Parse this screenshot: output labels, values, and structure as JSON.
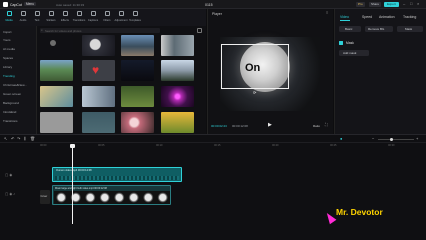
{
  "app": {
    "name": "CapCut",
    "menu": "Menu",
    "autosave": "Auto saved: 11:30:33",
    "project": "0115",
    "pro_label": "Pro",
    "share_label": "Share",
    "export_label": "Export"
  },
  "toolbar": {
    "items": [
      {
        "label": "Media",
        "icon": "media-icon",
        "active": true
      },
      {
        "label": "Audio",
        "icon": "audio-icon",
        "active": false
      },
      {
        "label": "Text",
        "icon": "text-icon",
        "active": false
      },
      {
        "label": "Stickers",
        "icon": "stickers-icon",
        "active": false
      },
      {
        "label": "Effects",
        "icon": "effects-icon",
        "active": false
      },
      {
        "label": "Transitions",
        "icon": "transitions-icon",
        "active": false
      },
      {
        "label": "Captions",
        "icon": "captions-icon",
        "active": false
      },
      {
        "label": "Filters",
        "icon": "filters-icon",
        "active": false
      },
      {
        "label": "Adjustment",
        "icon": "adjustment-icon",
        "active": false
      },
      {
        "label": "Templates",
        "icon": "templates-icon",
        "active": false
      }
    ]
  },
  "sidebar": {
    "items": [
      "Import",
      "Yours",
      "AI media",
      "Spaces",
      "Library",
      "Trending",
      "Christmas&New...",
      "Green screen",
      "Background",
      "Intro&End",
      "Transitions"
    ],
    "active": "Trending"
  },
  "media": {
    "search_placeholder": "Search for videos and photos",
    "thumbs": [
      "full-moon-night",
      "full-moon-sky",
      "city-buildings",
      "green-landscape",
      "heart-frame",
      "dark-night-space",
      "mountain-snow",
      "beach-light",
      "tall-building",
      "forest-road",
      "neon-heart-tunnel",
      "rose-flowers",
      "pink-flowers",
      "sunflower-field"
    ]
  },
  "player": {
    "title": "Player",
    "overlay_text": "On",
    "current_time": "00:00:02:23",
    "duration": "00:00:12:08",
    "ratio_label": "Ratio"
  },
  "properties": {
    "tabs": [
      "Video",
      "Speed",
      "Animation",
      "Tracking"
    ],
    "active_tab": "Video",
    "subtabs": [
      "Basic",
      "Remove BG",
      "Mask"
    ],
    "section": "Mask",
    "add_label": "Add mask"
  },
  "timeline": {
    "clip1_label": "Oumen video.mp4  00:00:12:08",
    "clip2_label": "Moon large and light bulb video.mp4  00:00:12:08",
    "cover_label": "Cover",
    "ruler": [
      "00:00",
      "00:05",
      "00:10",
      "00:15",
      "00:20",
      "00:25",
      "00:30"
    ]
  },
  "watermark": {
    "text": "Mr. Devotor"
  },
  "colors": {
    "accent": "#2fd1d8",
    "clip": "#0f5e63",
    "watermark": "#ffd400",
    "cursor": "#ff2bd6"
  }
}
